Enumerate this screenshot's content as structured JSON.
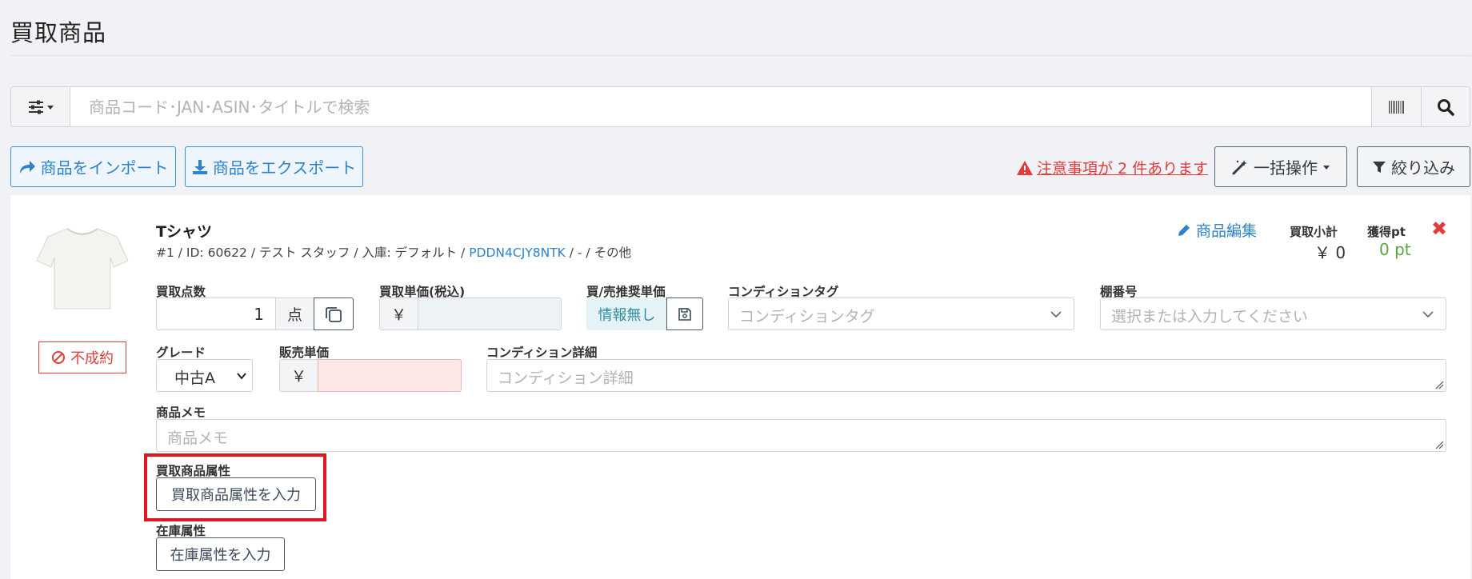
{
  "page": {
    "title": "買取商品"
  },
  "search": {
    "placeholder": "商品コード･JAN･ASIN･タイトルで検索",
    "filter_icon": "sliders-icon",
    "barcode_icon": "barcode-icon",
    "search_icon": "search-icon"
  },
  "toolbar": {
    "import_label": "商品をインポート",
    "export_label": "商品をエクスポート",
    "warning_text": "注意事項が 2 件あります",
    "bulk_label": "一括操作",
    "filter_label": "絞り込み"
  },
  "item": {
    "status_badge": "不成約",
    "name": "Tシャツ",
    "meta_prefix": "#1 / ID: 60622 / テスト スタッフ / 入庫: デフォルト / ",
    "meta_code": "PDDN4CJY8NTK",
    "meta_suffix": " / - / その他",
    "edit_label": "商品編集",
    "subtotal_label": "買取小計",
    "subtotal_value": "￥ 0",
    "pt_label": "獲得pt",
    "pt_value": "0 pt",
    "fields": {
      "quantity_label": "買取点数",
      "quantity_value": "1",
      "quantity_unit": "点",
      "unit_price_label": "買取単価(税込)",
      "currency": "￥",
      "recommend_label": "買/売推奨単価",
      "recommend_value": "情報無し",
      "condition_tag_label": "コンディションタグ",
      "condition_tag_placeholder": "コンディションタグ",
      "shelf_label": "棚番号",
      "shelf_placeholder": "選択または入力してください",
      "grade_label": "グレード",
      "grade_value": "中古A",
      "sale_price_label": "販売単価",
      "condition_detail_label": "コンディション詳細",
      "condition_detail_placeholder": "コンディション詳細",
      "memo_label": "商品メモ",
      "memo_placeholder": "商品メモ",
      "attr_label": "買取商品属性",
      "attr_button": "買取商品属性を入力",
      "stock_attr_label": "在庫属性",
      "stock_attr_button": "在庫属性を入力"
    }
  },
  "colors": {
    "accent_blue": "#2d82c9",
    "danger_red": "#e33a3a",
    "highlight_red": "#e0151f",
    "pt_green": "#5aa63f"
  }
}
